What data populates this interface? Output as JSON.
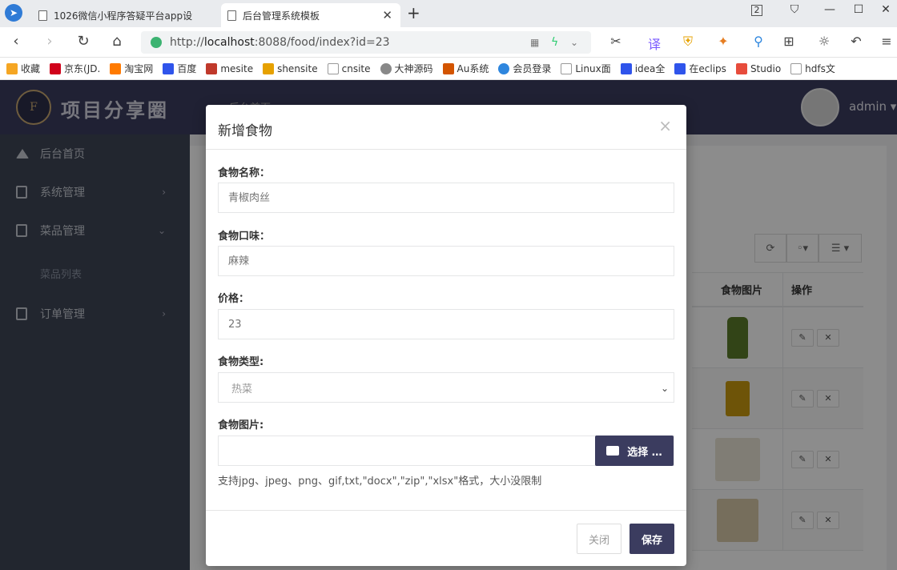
{
  "browser": {
    "tabs": [
      {
        "label": "1026微信小程序答疑平台app设",
        "active": false
      },
      {
        "label": "后台管理系统模板",
        "active": true
      }
    ],
    "tab_counter": "2",
    "url_prefix": "http://",
    "url_host": "localhost",
    "url_rest": ":8088/food/index?id=23",
    "bookmarks": [
      {
        "label": "收藏",
        "color": "#f5a623"
      },
      {
        "label": "京东(JD.",
        "color": "#d0021b"
      },
      {
        "label": "淘宝网",
        "color": "#ff7a00"
      },
      {
        "label": "百度",
        "color": "#2f54eb"
      },
      {
        "label": "mesite",
        "color": "#c0392b"
      },
      {
        "label": "shensite",
        "color": "#e6a100"
      },
      {
        "label": "cnsite",
        "color": "#999999"
      },
      {
        "label": "大神源码",
        "color": "#888888"
      },
      {
        "label": "Au系统",
        "color": "#d35400"
      },
      {
        "label": "会员登录",
        "color": "#2e86de"
      },
      {
        "label": "Linux面",
        "color": "#999999"
      },
      {
        "label": "idea全",
        "color": "#2f54eb"
      },
      {
        "label": "在eclips",
        "color": "#2f54eb"
      },
      {
        "label": "Studio",
        "color": "#e74c3c"
      },
      {
        "label": "hdfs文",
        "color": "#999999"
      }
    ]
  },
  "app": {
    "logo_mark": "F",
    "logo_text": "项目分享圈",
    "header_crumb": "后台首页",
    "username": "admin ▾",
    "sidebar": [
      {
        "label": "后台首页",
        "icon": "home-icon",
        "arrow": ""
      },
      {
        "label": "系统管理",
        "icon": "file-icon",
        "arrow": "›"
      },
      {
        "label": "菜品管理",
        "icon": "file-icon",
        "arrow": "⌄"
      },
      {
        "label": "订单管理",
        "icon": "file-icon",
        "arrow": "›"
      }
    ],
    "sidebar_sub": "菜品列表",
    "table": {
      "headers": [
        "食物图片",
        "操作"
      ],
      "tools": [
        "⟳",
        "◦▾",
        "☰ ▾"
      ],
      "rows": [
        {
          "img_color": "#5b7d2a"
        },
        {
          "img_color": "#c89a10"
        },
        {
          "img_color": "#e9e3d6"
        },
        {
          "img_color": "#d8c9a8"
        }
      ]
    }
  },
  "modal": {
    "title": "新增食物",
    "close": "×",
    "fields": {
      "name_label": "食物名称：",
      "name_placeholder": "青椒肉丝",
      "taste_label": "食物口味：",
      "taste_placeholder": "麻辣",
      "price_label": "价格：",
      "price_placeholder": "23",
      "type_label": "食物类型:",
      "type_value": "热菜",
      "image_label": "食物图片:"
    },
    "file_button": "选择 …",
    "file_hint": "支持jpg、jpeg、png、gif,txt,\"docx\",\"zip\",\"xlsx\"格式，大小没限制",
    "close_button": "关闭",
    "save_button": "保存"
  }
}
